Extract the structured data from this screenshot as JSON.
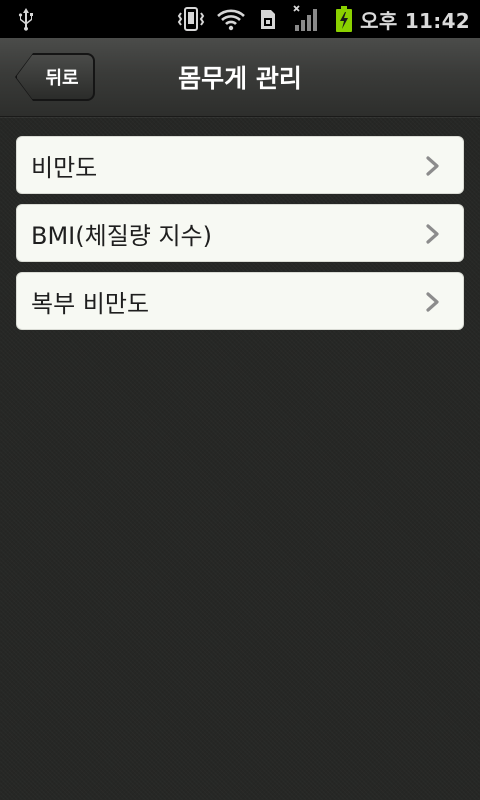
{
  "status_bar": {
    "time": "오후 11:42",
    "icons": [
      "usb-icon",
      "vibrate-icon",
      "wifi-icon",
      "sim-icon",
      "signal-icon",
      "battery-charging-icon"
    ]
  },
  "header": {
    "back_label": "뒤로",
    "title": "몸무게 관리"
  },
  "menu": {
    "items": [
      {
        "label": "비만도",
        "icon": "chevron-right-icon"
      },
      {
        "label": "BMI(체질량 지수)",
        "icon": "chevron-right-icon"
      },
      {
        "label": "복부 비만도",
        "icon": "chevron-right-icon"
      }
    ]
  },
  "colors": {
    "background": "#262725",
    "list_item_bg": "#f7f9f3",
    "battery_accent": "#8bd100"
  }
}
